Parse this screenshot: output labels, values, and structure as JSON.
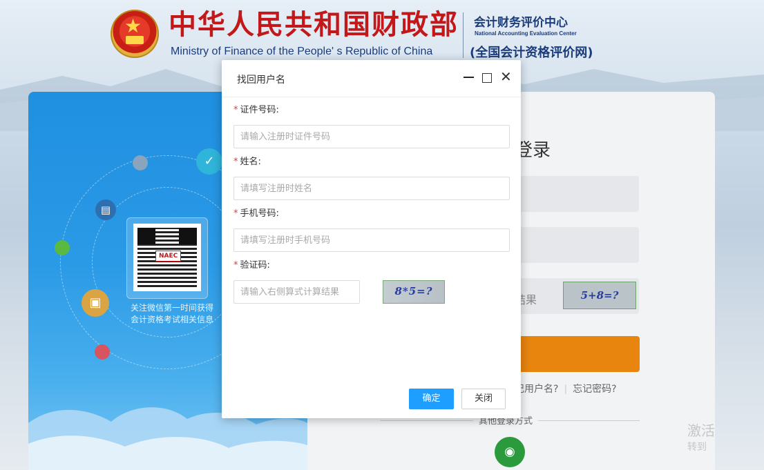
{
  "header": {
    "title_cn": "中华人民共和国财政部",
    "title_en": "Ministry of Finance of the People' s Republic of China",
    "center_cn": "会计财务评价中心",
    "center_en": "National Accounting Evaluation Center",
    "center_sub": "(全国会计资格评价网)"
  },
  "left_panel": {
    "qr_badge": "NAEC",
    "qr_caption_line1": "关注微信第一时间获得",
    "qr_caption_line2": "会计资格考试相关信息"
  },
  "login_panel": {
    "title_partial": "登录",
    "captcha_hint_partial": "结果",
    "captcha_text": "5+8=?",
    "forgot_username_partial": "记用户名?",
    "forgot_password": "忘记密码?",
    "other_login": "其他登录方式",
    "wechat_icon": "wechat-icon"
  },
  "watermark": {
    "line1": "激活",
    "line2": "转到"
  },
  "modal": {
    "title": "找回用户名",
    "fields": {
      "id_number": {
        "label": "证件号码:",
        "placeholder": "请输入注册时证件号码",
        "value": ""
      },
      "name": {
        "label": "姓名:",
        "placeholder": "请填写注册时姓名",
        "value": ""
      },
      "phone": {
        "label": "手机号码:",
        "placeholder": "请填写注册时手机号码",
        "value": ""
      },
      "captcha": {
        "label": "验证码:",
        "placeholder": "请输入右侧算式计算结果",
        "value": "",
        "image_text": "8*5=?"
      }
    },
    "required_mark": "*",
    "ok_button": "确定",
    "close_button": "关闭"
  },
  "colors": {
    "accent_blue": "#1e9fff",
    "title_red": "#c3181a",
    "login_orange": "#e7850f",
    "required_red": "#e23b3b"
  }
}
